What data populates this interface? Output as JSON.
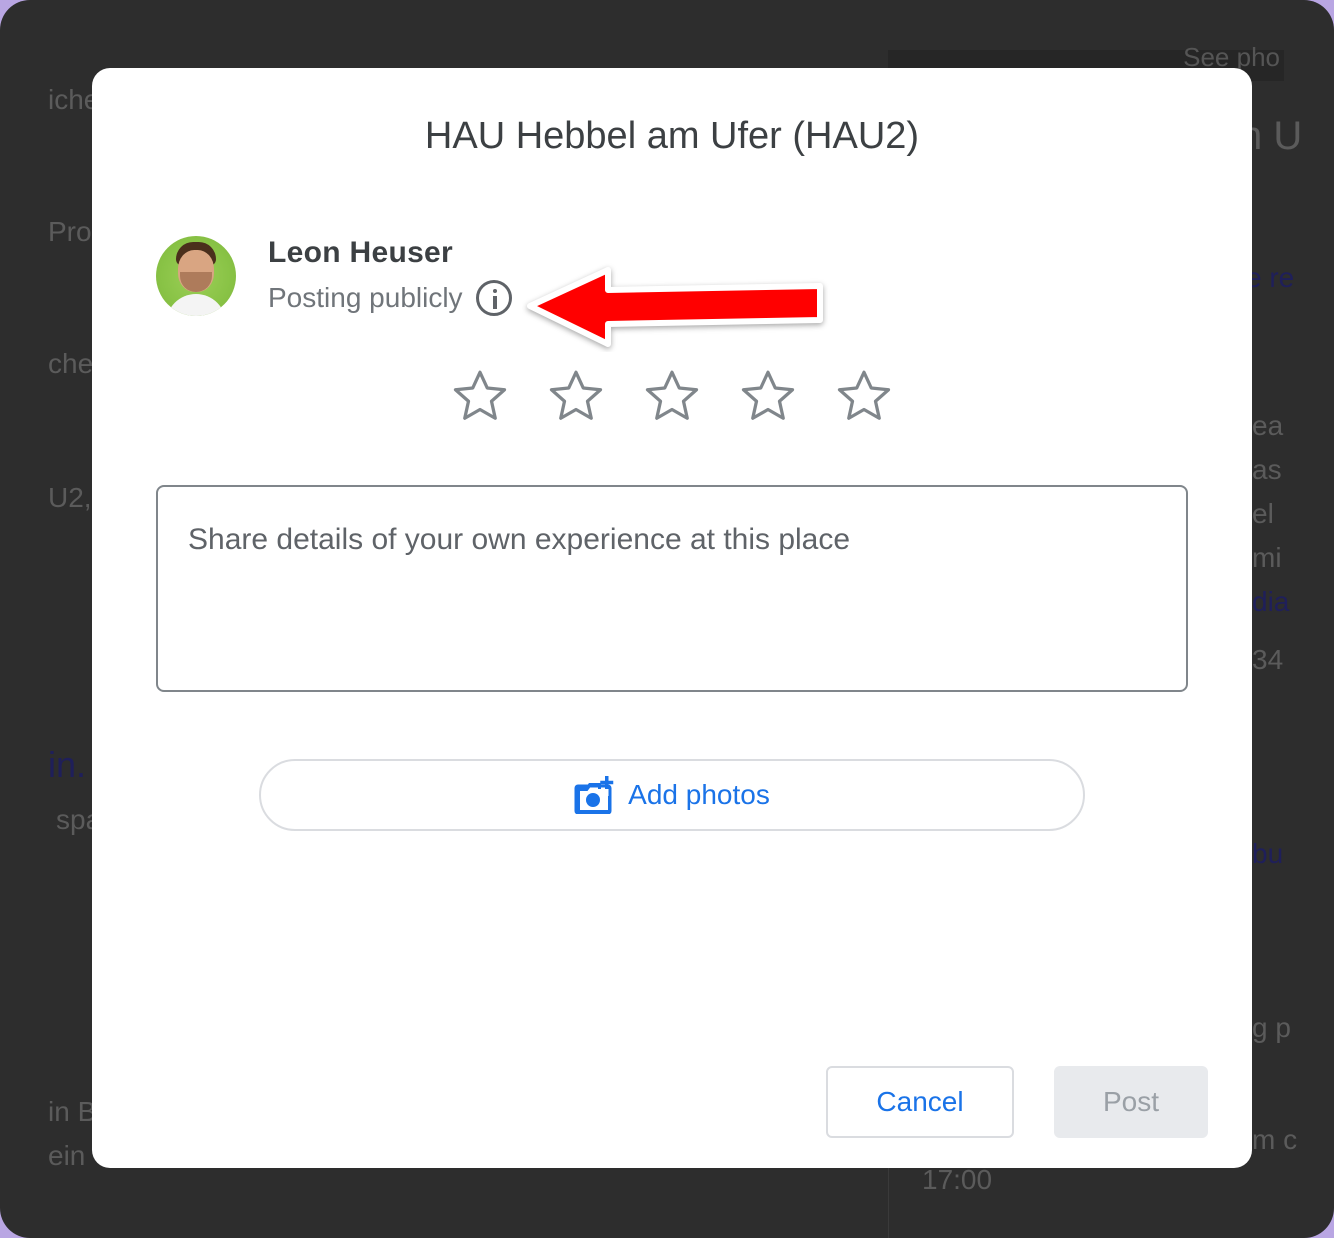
{
  "background": {
    "fragments": [
      "iche",
      "Pro",
      "che",
      "U2,",
      "in.",
      "spa",
      "in B",
      "ein",
      "n U",
      "e re",
      "ea",
      "as",
      "el",
      "mi",
      "dia",
      "34",
      "bu",
      "g p",
      "m c",
      "17:00",
      "See pho"
    ]
  },
  "dialog": {
    "title": "HAU Hebbel am Ufer (HAU2)",
    "user": {
      "name": "Leon Heuser",
      "posting_status": "Posting publicly"
    },
    "rating": {
      "value": 0,
      "max": 5
    },
    "review": {
      "placeholder": "Share details of your own experience at this place",
      "value": ""
    },
    "add_photos_label": "Add photos",
    "cancel_label": "Cancel",
    "post_label": "Post"
  },
  "colors": {
    "accent": "#1a73e8",
    "annotation_arrow": "#ff0000",
    "disabled_button_bg": "#e8eaed"
  },
  "icons": [
    "info-icon",
    "star-outline-icon",
    "add-photo-camera-icon",
    "red-arrow-annotation"
  ]
}
